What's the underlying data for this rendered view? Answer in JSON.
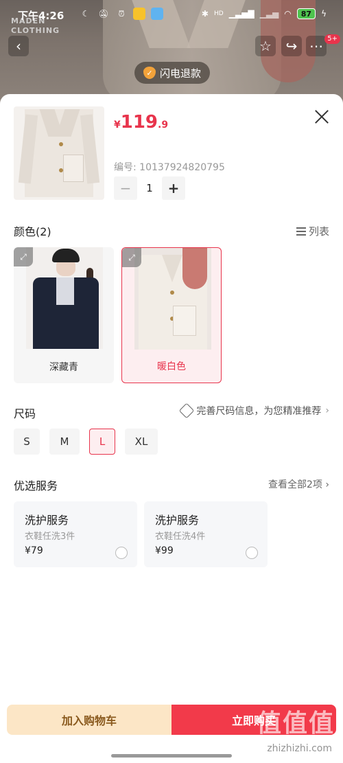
{
  "status_bar": {
    "time": "下午4:26",
    "battery": "87",
    "signal_label": "HD"
  },
  "background": {
    "brand_line1": "MADEN",
    "brand_line2": "CLOTHING"
  },
  "nav": {
    "badge": "5+"
  },
  "refund_pill": {
    "label": "闪电退款"
  },
  "product": {
    "price_currency": "¥",
    "price_int": "119",
    "price_dec": ".9",
    "sku_label": "编号: 10137924820795",
    "quantity": "1"
  },
  "color_section": {
    "title": "颜色(2)",
    "list_toggle": "列表",
    "options": [
      {
        "label": "深藏青",
        "selected": false
      },
      {
        "label": "暖白色",
        "selected": true
      }
    ]
  },
  "size_section": {
    "title": "尺码",
    "hint": "完善尺码信息，为您精准推荐",
    "sizes": [
      {
        "label": "S",
        "selected": false
      },
      {
        "label": "M",
        "selected": false
      },
      {
        "label": "L",
        "selected": true
      },
      {
        "label": "XL",
        "selected": false
      }
    ]
  },
  "service_section": {
    "title": "优选服务",
    "view_all": "查看全部2项",
    "items": [
      {
        "name": "洗护服务",
        "desc": "衣鞋任洗3件",
        "price": "¥79"
      },
      {
        "name": "洗护服务",
        "desc": "衣鞋任洗4件",
        "price": "¥99"
      }
    ]
  },
  "actions": {
    "add_to_cart": "加入购物车",
    "buy_now": "立即购买"
  },
  "watermark": {
    "text": "值值值",
    "url": "zhizhizhi.com"
  },
  "colors": {
    "accent": "#e8344c",
    "cart_bg": "#fce6c6",
    "buy_bg": "#f23a4a"
  }
}
